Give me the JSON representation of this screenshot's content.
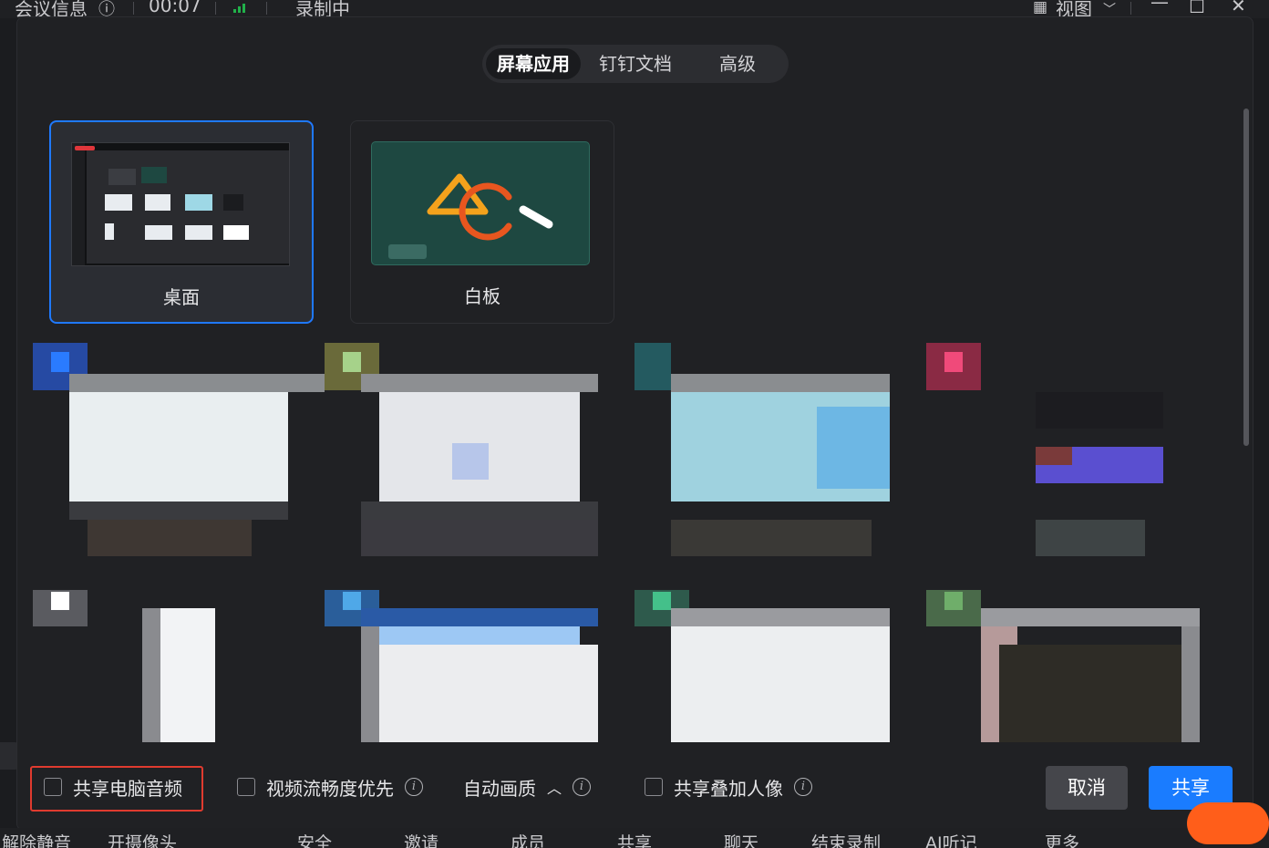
{
  "topbar": {
    "meeting_info": "会议信息",
    "timer": "00:07",
    "recording": "录制中",
    "view": "视图"
  },
  "dialog": {
    "tabs": [
      {
        "label": "屏幕应用",
        "active": true
      },
      {
        "label": "钉钉文档",
        "active": false
      },
      {
        "label": "高级",
        "active": false
      }
    ],
    "sources": [
      {
        "label": "桌面",
        "selected": true
      },
      {
        "label": "白板",
        "selected": false
      }
    ],
    "footer": {
      "share_audio": "共享电脑音频",
      "video_smooth": "视频流畅度优先",
      "auto_quality": "自动画质",
      "share_overlay": "共享叠加人像",
      "cancel": "取消",
      "share": "共享"
    }
  },
  "bottombar": {
    "items": [
      "解除静音",
      "开摄像头",
      "安全",
      "邀请",
      "成员",
      "共享",
      "聊天",
      "结束录制",
      "AI听记",
      "更多"
    ]
  },
  "colors": {
    "accent": "#1a7cff",
    "highlight_border": "#e03b2f",
    "recording_signal": "#21b14a"
  }
}
